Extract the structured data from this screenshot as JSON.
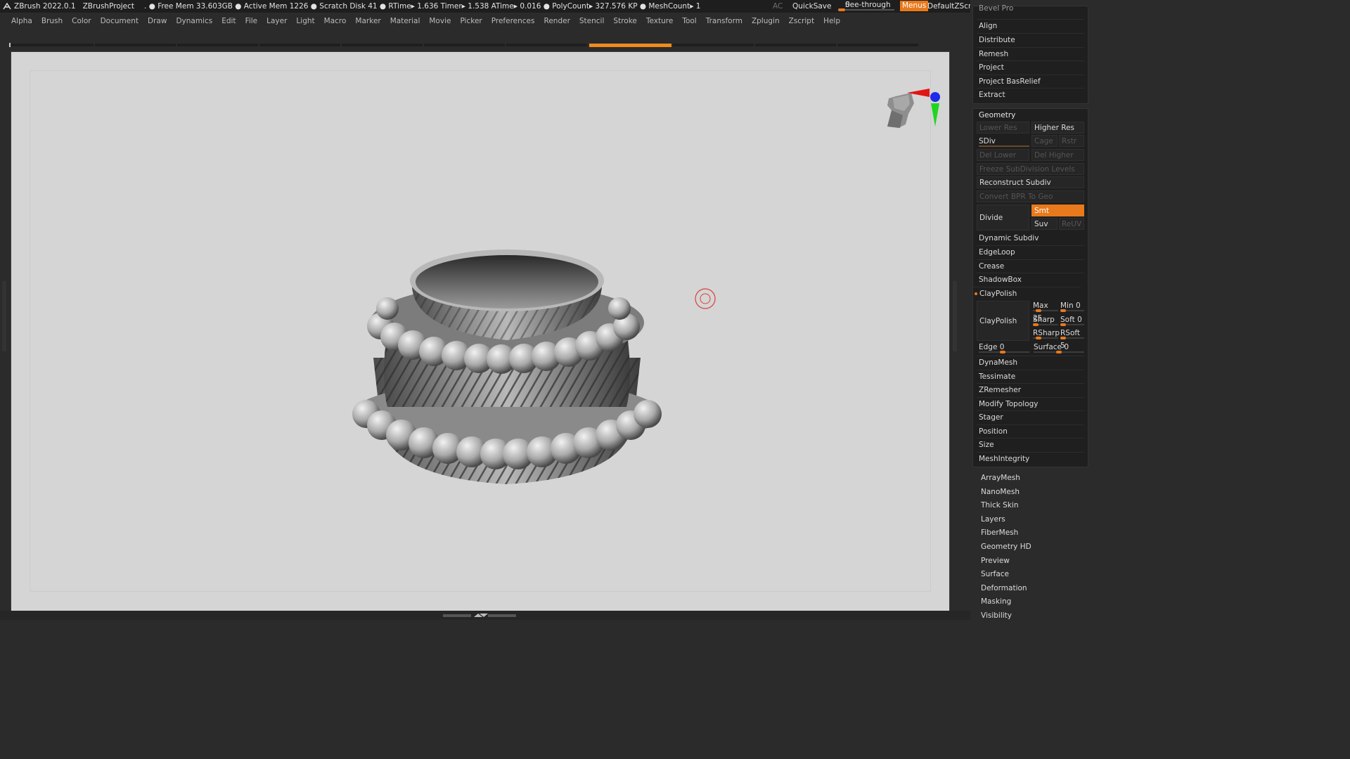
{
  "titlebar": {
    "app": "ZBrush 2022.0.1",
    "project": "ZBrushProject",
    "stats": ". ● Free Mem 33.603GB ● Active Mem 1226 ● Scratch Disk 41 ● RTime▸ 1.636 Timer▸ 1.538 ATime▸ 0.016 ● PolyCount▸ 327.576 KP ● MeshCount▸ 1",
    "ac": "AC",
    "quicksave": "QuickSave",
    "seethrough_label": "See-through",
    "seethrough_value": "0",
    "menus": "Menus",
    "script": "DefaultZScript"
  },
  "menubar": [
    "Alpha",
    "Brush",
    "Color",
    "Document",
    "Draw",
    "Dynamics",
    "Edit",
    "File",
    "Layer",
    "Light",
    "Macro",
    "Marker",
    "Material",
    "Movie",
    "Picker",
    "Preferences",
    "Render",
    "Stencil",
    "Stroke",
    "Texture",
    "Tool",
    "Transform",
    "Zplugin",
    "Zscript",
    "Help"
  ],
  "panel": {
    "top_partial": "Bevel Pro",
    "top_items": [
      "Align",
      "Distribute",
      "Remesh",
      "Project",
      "Project BasRelief",
      "Extract"
    ],
    "geometry": {
      "title": "Geometry",
      "lower_res": "Lower Res",
      "higher_res": "Higher Res",
      "sdiv": "SDiv",
      "cage": "Cage",
      "rstr": "Rstr",
      "del_lower": "Del Lower",
      "del_higher": "Del Higher",
      "freeze": "Freeze SubDivision Levels",
      "reconstruct": "Reconstruct Subdiv",
      "convert": "Convert BPR To Geo",
      "divide": "Divide",
      "smt": "Smt",
      "suv": "Suv",
      "reuv": "ReUV",
      "dynamic_subdiv": "Dynamic Subdiv",
      "edgeloop": "EdgeLoop",
      "crease": "Crease",
      "shadowbox": "ShadowBox",
      "claypolish": "ClayPolish",
      "claypolish_btn": "ClayPolish",
      "max_label": "Max",
      "max_val": "25",
      "min_label": "Min",
      "min_val": "0",
      "sharp_label": "Sharp",
      "sharp_val": "",
      "soft_label": "Soft",
      "soft_val": "0",
      "rsharp_label": "RSharp",
      "rsharp_val": "",
      "rsoft_label": "RSoft",
      "rsoft_val": "5",
      "edge_label": "Edge",
      "edge_val": "0",
      "surface_label": "Surface",
      "surface_val": "0",
      "more": [
        "DynaMesh",
        "Tessimate",
        "ZRemesher",
        "Modify Topology",
        "Stager",
        "Position",
        "Size",
        "MeshIntegrity"
      ]
    },
    "bottom_items": [
      "ArrayMesh",
      "NanoMesh",
      "Thick Skin",
      "Layers",
      "FiberMesh",
      "Geometry HD",
      "Preview",
      "Surface",
      "Deformation",
      "Masking",
      "Visibility"
    ]
  },
  "colors": {
    "accent": "#e8791c",
    "viewport": "#d5d5d5",
    "background": "#2b2b2b"
  }
}
